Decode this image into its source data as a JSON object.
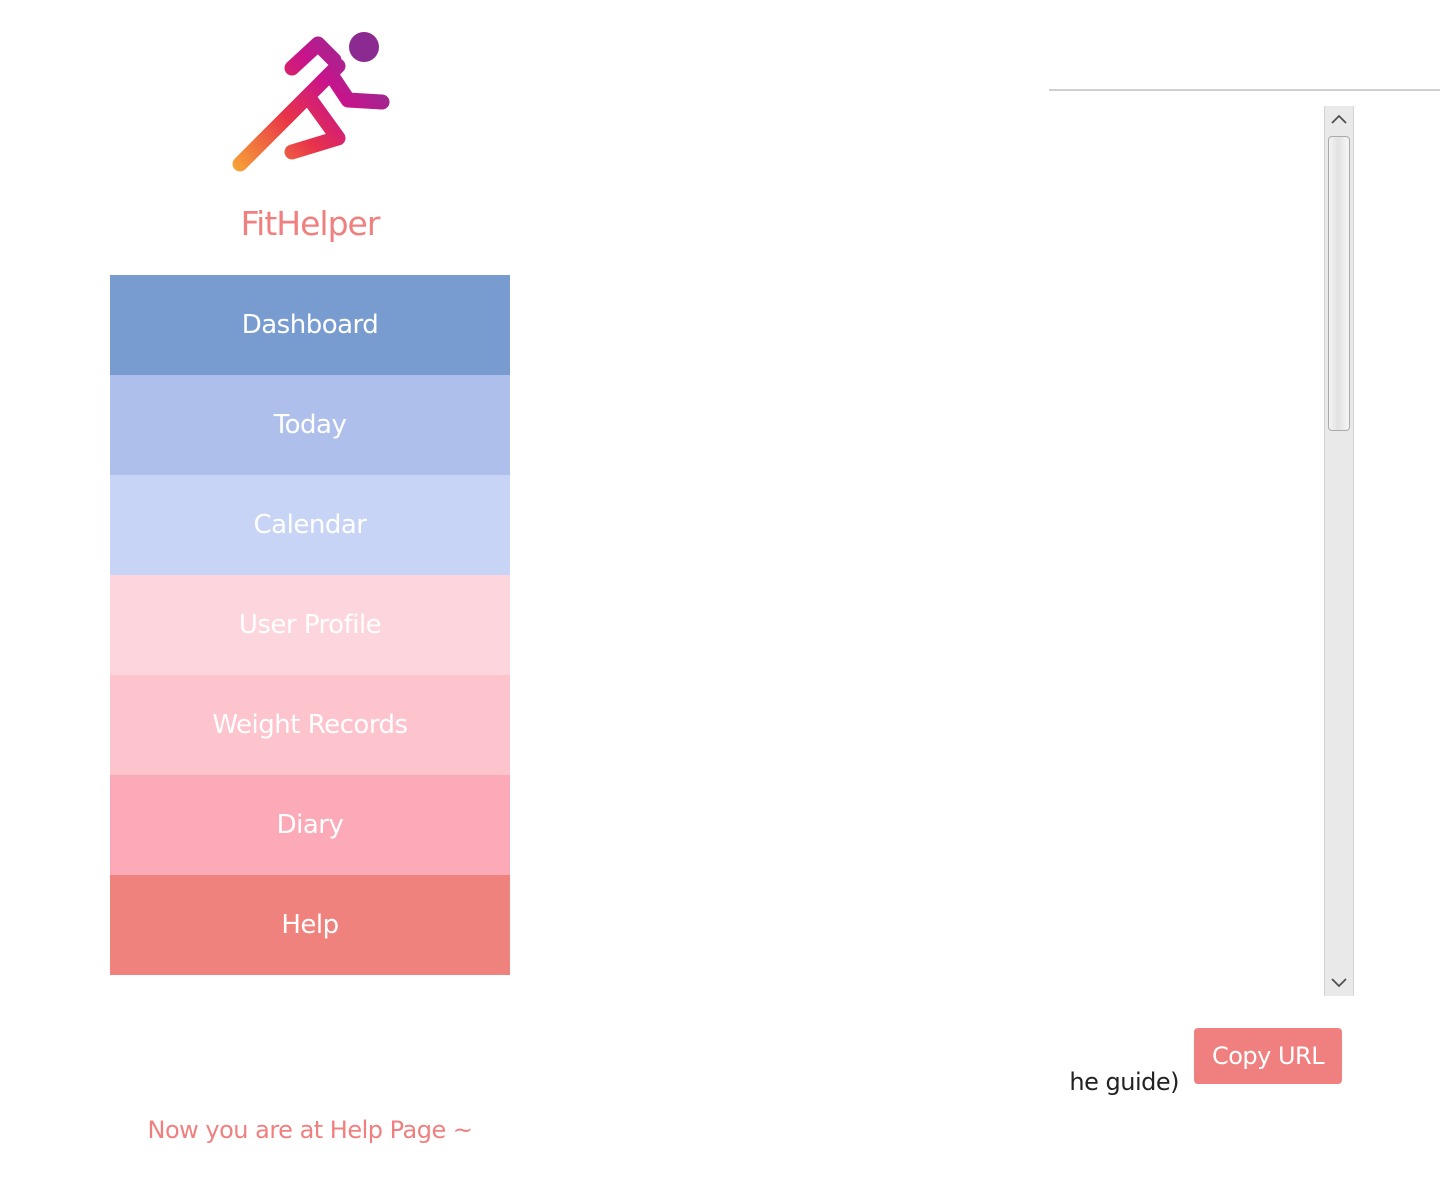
{
  "app": {
    "brand": "FitHelper",
    "logo_icon": "running-person-icon"
  },
  "sidebar": {
    "items": [
      {
        "label": "Dashboard",
        "color": "#799cd0"
      },
      {
        "label": "Today",
        "color": "#adbfea"
      },
      {
        "label": "Calendar",
        "color": "#c8d4f5"
      },
      {
        "label": "User Profile",
        "color": "#fdd5dc"
      },
      {
        "label": "Weight Records",
        "color": "#fdc4cd"
      },
      {
        "label": "Diary",
        "color": "#fdaab8"
      },
      {
        "label": "Help",
        "color": "#f0827d"
      }
    ],
    "status": "Now you are at Help Page ~"
  },
  "help_panel": {
    "guide_text_fragment": "he guide)",
    "copy_button_label": "Copy URL",
    "scroll_up_icon": "chevron-up-icon",
    "scroll_down_icon": "chevron-down-icon"
  },
  "colors": {
    "accent": "#f08080",
    "logo_gradient": [
      "#f9b233",
      "#e8334a",
      "#c8138c",
      "#962c8e",
      "#3f3a8f"
    ]
  }
}
